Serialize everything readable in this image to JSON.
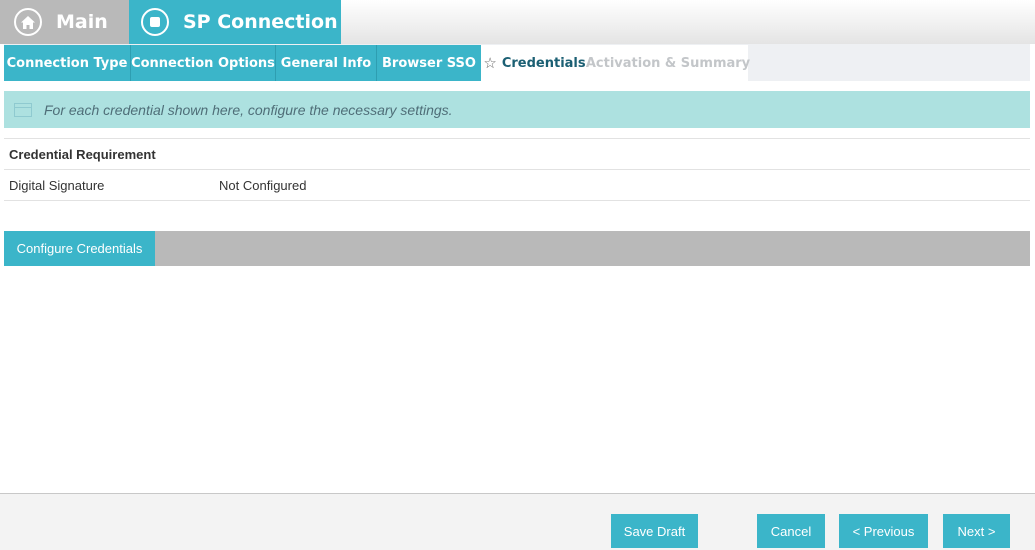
{
  "header": {
    "main_label": "Main",
    "main_icon": "home-icon",
    "sp_label": "SP Connection",
    "sp_icon": "stop-circle-icon"
  },
  "tabs": [
    {
      "label": "Connection Type",
      "state": "completed"
    },
    {
      "label": "Connection Options",
      "state": "completed"
    },
    {
      "label": "General Info",
      "state": "completed"
    },
    {
      "label": "Browser SSO",
      "state": "completed"
    },
    {
      "label": "Credentials",
      "state": "current",
      "icon": "star-icon"
    },
    {
      "label": "Activation & Summary",
      "state": "disabled"
    }
  ],
  "banner": {
    "text": "For each credential shown here, configure the necessary settings."
  },
  "table": {
    "header": "Credential Requirement",
    "rows": [
      {
        "name": "Digital Signature",
        "status": "Not Configured"
      }
    ]
  },
  "configure_button": "Configure Credentials",
  "footer": {
    "save_draft": "Save Draft",
    "cancel": "Cancel",
    "previous": "< Previous",
    "next": "Next >"
  },
  "colors": {
    "accent": "#3bb5c9",
    "inactive": "#b9b9b9",
    "banner": "#ade1e0"
  }
}
